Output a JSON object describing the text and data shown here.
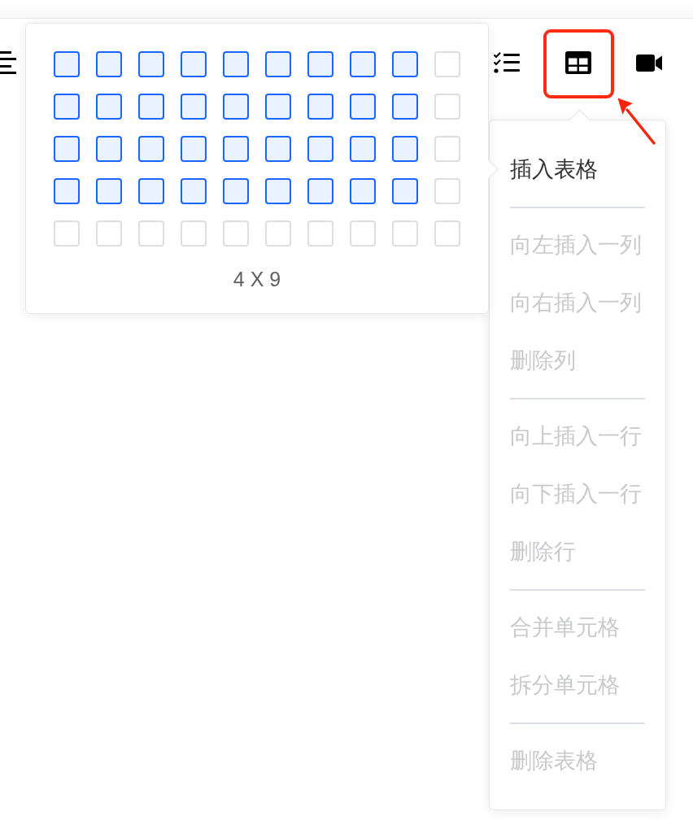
{
  "toolbar": [
    {
      "kind": "align",
      "highlighted": false
    },
    {
      "kind": "checklist",
      "highlighted": false
    },
    {
      "kind": "table",
      "highlighted": true
    },
    {
      "kind": "video",
      "highlighted": false
    }
  ],
  "table_picker": {
    "rows": [
      {
        "cells": [
          {
            "selected": true
          },
          {
            "selected": true
          },
          {
            "selected": true
          },
          {
            "selected": true
          },
          {
            "selected": true
          },
          {
            "selected": true
          },
          {
            "selected": true
          },
          {
            "selected": true
          },
          {
            "selected": true
          },
          {
            "selected": false
          }
        ]
      },
      {
        "cells": [
          {
            "selected": true
          },
          {
            "selected": true
          },
          {
            "selected": true
          },
          {
            "selected": true
          },
          {
            "selected": true
          },
          {
            "selected": true
          },
          {
            "selected": true
          },
          {
            "selected": true
          },
          {
            "selected": true
          },
          {
            "selected": false
          }
        ]
      },
      {
        "cells": [
          {
            "selected": true
          },
          {
            "selected": true
          },
          {
            "selected": true
          },
          {
            "selected": true
          },
          {
            "selected": true
          },
          {
            "selected": true
          },
          {
            "selected": true
          },
          {
            "selected": true
          },
          {
            "selected": true
          },
          {
            "selected": false
          }
        ]
      },
      {
        "cells": [
          {
            "selected": true
          },
          {
            "selected": true
          },
          {
            "selected": true
          },
          {
            "selected": true
          },
          {
            "selected": true
          },
          {
            "selected": true
          },
          {
            "selected": true
          },
          {
            "selected": true
          },
          {
            "selected": true
          },
          {
            "selected": false
          }
        ]
      },
      {
        "cells": [
          {
            "selected": false
          },
          {
            "selected": false
          },
          {
            "selected": false
          },
          {
            "selected": false
          },
          {
            "selected": false
          },
          {
            "selected": false
          },
          {
            "selected": false
          },
          {
            "selected": false
          },
          {
            "selected": false
          },
          {
            "selected": false
          }
        ]
      }
    ],
    "size_label": "4 X 9"
  },
  "menu": {
    "groups": [
      {
        "items": [
          {
            "label": "插入表格",
            "disabled": false
          }
        ]
      },
      {
        "items": [
          {
            "label": "向左插入一列",
            "disabled": true
          },
          {
            "label": "向右插入一列",
            "disabled": true
          },
          {
            "label": "删除列",
            "disabled": true
          }
        ]
      },
      {
        "items": [
          {
            "label": "向上插入一行",
            "disabled": true
          },
          {
            "label": "向下插入一行",
            "disabled": true
          },
          {
            "label": "删除行",
            "disabled": true
          }
        ]
      },
      {
        "items": [
          {
            "label": "合并单元格",
            "disabled": true
          },
          {
            "label": "拆分单元格",
            "disabled": true
          }
        ]
      },
      {
        "items": [
          {
            "label": "删除表格",
            "disabled": true
          }
        ]
      }
    ]
  }
}
